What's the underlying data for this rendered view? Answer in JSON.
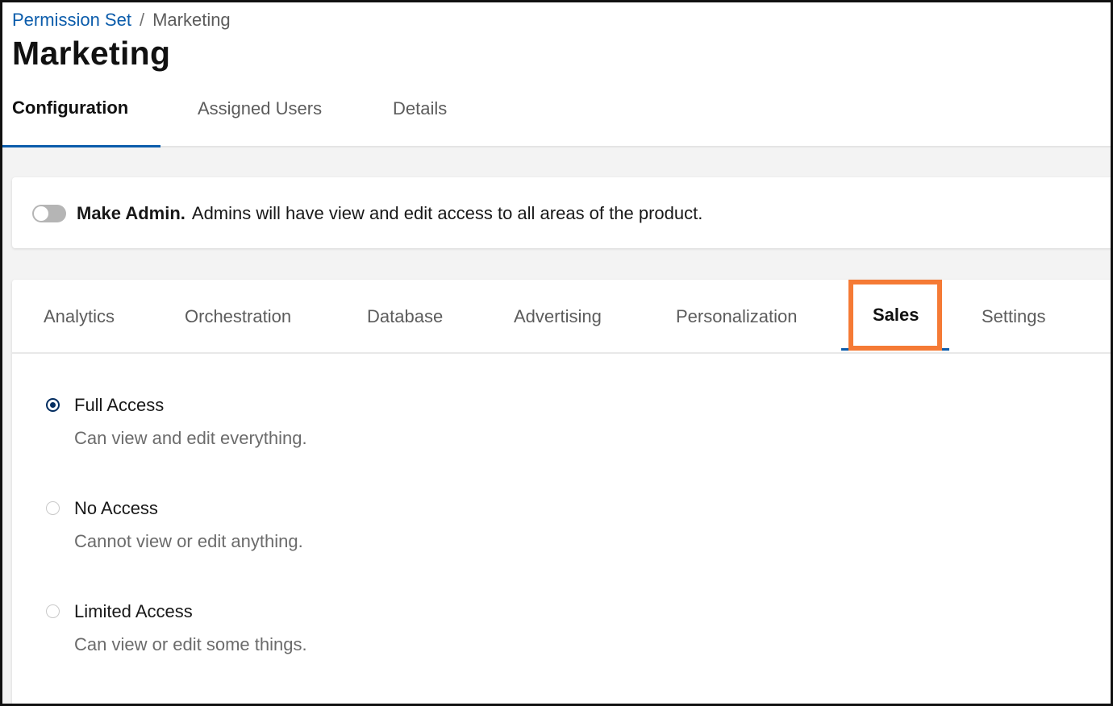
{
  "breadcrumb": {
    "parent": "Permission Set",
    "separator": "/",
    "current": "Marketing"
  },
  "page_title": "Marketing",
  "top_tabs": [
    {
      "label": "Configuration",
      "active": true
    },
    {
      "label": "Assigned Users",
      "active": false
    },
    {
      "label": "Details",
      "active": false
    }
  ],
  "admin": {
    "toggle_on": false,
    "label": "Make Admin.",
    "description": "Admins will have view and edit access to all areas of the product."
  },
  "category_tabs": [
    {
      "label": "Analytics",
      "active": false
    },
    {
      "label": "Orchestration",
      "active": false
    },
    {
      "label": "Database",
      "active": false
    },
    {
      "label": "Advertising",
      "active": false
    },
    {
      "label": "Personalization",
      "active": false
    },
    {
      "label": "Sales",
      "active": true
    },
    {
      "label": "Settings",
      "active": false
    }
  ],
  "access_options": [
    {
      "label": "Full Access",
      "description": "Can view and edit everything.",
      "selected": true
    },
    {
      "label": "No Access",
      "description": "Cannot view or edit anything.",
      "selected": false
    },
    {
      "label": "Limited Access",
      "description": "Can view or edit some things.",
      "selected": false
    }
  ],
  "colors": {
    "link": "#0b5cab",
    "active_underline": "#0b5cab",
    "highlight_box": "#f57a35",
    "radio_selected": "#032d60",
    "canvas_background": "#f3f3f3"
  }
}
